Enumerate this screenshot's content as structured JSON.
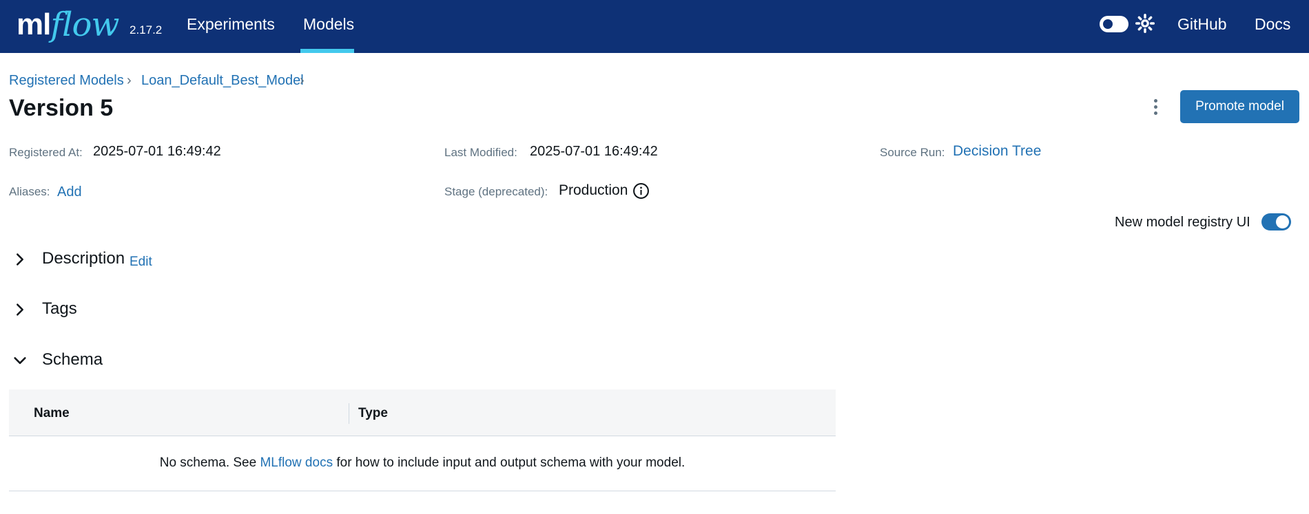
{
  "nav": {
    "logo_ml": "ml",
    "logo_flow": "flow",
    "version": "2.17.2",
    "experiments": "Experiments",
    "models": "Models",
    "github": "GitHub",
    "docs": "Docs",
    "active_tab": "Models",
    "theme_toggle_on": false
  },
  "breadcrumb": {
    "items": [
      "Registered Models",
      "Loan_Default_Best_Model"
    ],
    "separator": "›"
  },
  "page": {
    "title": "Version 5",
    "promote_label": "Promote model"
  },
  "metadata": {
    "registered_at_label": "Registered At:",
    "registered_at_value": "2025-07-01 16:49:42",
    "last_modified_label": "Last Modified:",
    "last_modified_value": "2025-07-01 16:49:42",
    "source_run_label": "Source Run:",
    "source_run_value": "Decision Tree",
    "aliases_label": "Aliases:",
    "aliases_add": "Add",
    "stage_label": "Stage (deprecated):",
    "stage_value": "Production"
  },
  "registry_toggle": {
    "label": "New model registry UI",
    "enabled": true
  },
  "sections": {
    "description": {
      "title": "Description",
      "edit": "Edit",
      "expanded": false
    },
    "tags": {
      "title": "Tags",
      "expanded": false
    },
    "schema": {
      "title": "Schema",
      "expanded": true
    }
  },
  "schema_table": {
    "columns": [
      "Name",
      "Type"
    ],
    "empty_prefix": "No schema. See ",
    "empty_link": "MLflow docs",
    "empty_suffix": " for how to include input and output schema with your model."
  },
  "colors": {
    "nav_bg": "#0e3176",
    "accent": "#43c9ed",
    "primary": "#2272b4",
    "text": "#11171c",
    "muted": "#5f7281"
  }
}
